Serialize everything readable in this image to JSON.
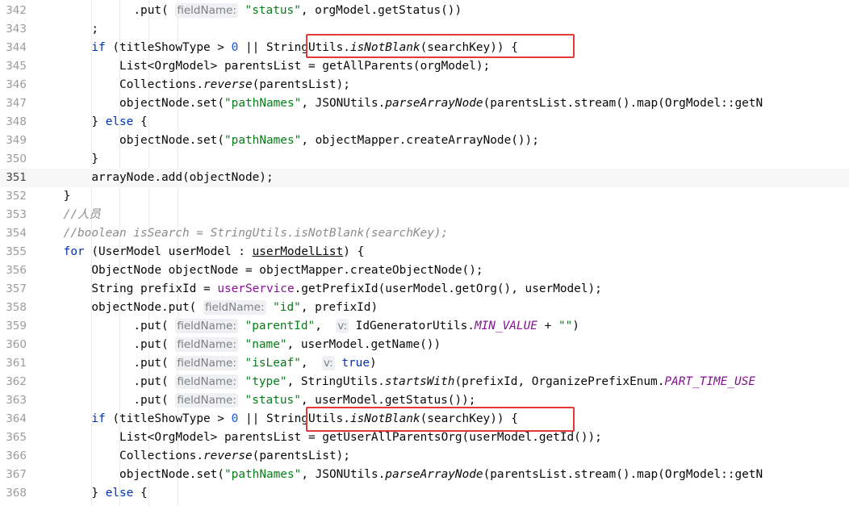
{
  "editor": {
    "current_line": "351",
    "lines": [
      {
        "n": "342",
        "indent": 14,
        "segs": [
          [
            "",
            ".put( "
          ],
          [
            "hint",
            "fieldName:"
          ],
          [
            "",
            " "
          ],
          [
            "str",
            "\"status\""
          ],
          [
            "",
            ", orgModel.getStatus())"
          ]
        ]
      },
      {
        "n": "343",
        "indent": 8,
        "segs": [
          [
            "",
            ";"
          ]
        ]
      },
      {
        "n": "344",
        "indent": 8,
        "segs": [
          [
            "kw",
            "if"
          ],
          [
            "",
            " (titleShowType > "
          ],
          [
            "num",
            "0"
          ],
          [
            "",
            " || StringUtils."
          ],
          [
            "it",
            "isNotBlank"
          ],
          [
            "",
            "(searchKey)) {"
          ]
        ]
      },
      {
        "n": "345",
        "indent": 12,
        "segs": [
          [
            "",
            "List<OrgModel> parentsList = getAllParents(orgModel);"
          ]
        ]
      },
      {
        "n": "346",
        "indent": 12,
        "segs": [
          [
            "",
            "Collections."
          ],
          [
            "it",
            "reverse"
          ],
          [
            "",
            "(parentsList);"
          ]
        ]
      },
      {
        "n": "347",
        "indent": 12,
        "segs": [
          [
            "",
            "objectNode.set("
          ],
          [
            "str",
            "\"pathNames\""
          ],
          [
            "",
            ", JSONUtils."
          ],
          [
            "it",
            "parseArrayNode"
          ],
          [
            "",
            "(parentsList.stream().map(OrgModel::getN"
          ]
        ]
      },
      {
        "n": "348",
        "indent": 8,
        "segs": [
          [
            "",
            "} "
          ],
          [
            "kw",
            "else"
          ],
          [
            "",
            " {"
          ]
        ]
      },
      {
        "n": "349",
        "indent": 12,
        "segs": [
          [
            "",
            "objectNode.set("
          ],
          [
            "str",
            "\"pathNames\""
          ],
          [
            "",
            ", objectMapper.createArrayNode());"
          ]
        ]
      },
      {
        "n": "350",
        "indent": 8,
        "segs": [
          [
            "",
            "}"
          ]
        ]
      },
      {
        "n": "351",
        "indent": 8,
        "segs": [
          [
            "",
            "arrayNode.add(objectNode);"
          ]
        ]
      },
      {
        "n": "352",
        "indent": 4,
        "segs": [
          [
            "",
            "}"
          ]
        ]
      },
      {
        "n": "353",
        "indent": 4,
        "segs": [
          [
            "cmt",
            "//人员"
          ]
        ]
      },
      {
        "n": "354",
        "indent": 4,
        "segs": [
          [
            "cmt",
            "//boolean isSearch = StringUtils.isNotBlank(searchKey);"
          ]
        ]
      },
      {
        "n": "355",
        "indent": 4,
        "segs": [
          [
            "kw",
            "for"
          ],
          [
            "",
            " (UserModel userModel : "
          ],
          [
            "ul",
            "userModelList"
          ],
          [
            "",
            ") {"
          ]
        ]
      },
      {
        "n": "356",
        "indent": 8,
        "segs": [
          [
            "",
            "ObjectNode objectNode = objectMapper.createObjectNode();"
          ]
        ]
      },
      {
        "n": "357",
        "indent": 8,
        "segs": [
          [
            "",
            "String prefixId = "
          ],
          [
            "field",
            "userService"
          ],
          [
            "",
            ".getPrefixId(userModel.getOrg(), userModel);"
          ]
        ]
      },
      {
        "n": "358",
        "indent": 8,
        "segs": [
          [
            "",
            "objectNode.put( "
          ],
          [
            "hint",
            "fieldName:"
          ],
          [
            "",
            " "
          ],
          [
            "str",
            "\"id\""
          ],
          [
            "",
            ", prefixId)"
          ]
        ]
      },
      {
        "n": "359",
        "indent": 14,
        "segs": [
          [
            "",
            ".put( "
          ],
          [
            "hint",
            "fieldName:"
          ],
          [
            "",
            " "
          ],
          [
            "str",
            "\"parentId\""
          ],
          [
            "",
            ",  "
          ],
          [
            "hint",
            "v:"
          ],
          [
            "",
            " IdGeneratorUtils."
          ],
          [
            "const",
            "MIN_VALUE"
          ],
          [
            "",
            " + "
          ],
          [
            "str",
            "\"\""
          ],
          [
            "",
            ")"
          ]
        ]
      },
      {
        "n": "360",
        "indent": 14,
        "segs": [
          [
            "",
            ".put( "
          ],
          [
            "hint",
            "fieldName:"
          ],
          [
            "",
            " "
          ],
          [
            "str",
            "\"name\""
          ],
          [
            "",
            ", userModel.getName())"
          ]
        ]
      },
      {
        "n": "361",
        "indent": 14,
        "segs": [
          [
            "",
            ".put( "
          ],
          [
            "hint",
            "fieldName:"
          ],
          [
            "",
            " "
          ],
          [
            "str",
            "\"isLeaf\""
          ],
          [
            "",
            ",  "
          ],
          [
            "hint",
            "v:"
          ],
          [
            "",
            " "
          ],
          [
            "kw",
            "true"
          ],
          [
            "",
            ")"
          ]
        ]
      },
      {
        "n": "362",
        "indent": 14,
        "segs": [
          [
            "",
            ".put( "
          ],
          [
            "hint",
            "fieldName:"
          ],
          [
            "",
            " "
          ],
          [
            "str",
            "\"type\""
          ],
          [
            "",
            ", StringUtils."
          ],
          [
            "it",
            "startsWith"
          ],
          [
            "",
            "(prefixId, OrganizePrefixEnum."
          ],
          [
            "const",
            "PART_TIME_USE"
          ]
        ]
      },
      {
        "n": "363",
        "indent": 14,
        "segs": [
          [
            "",
            ".put( "
          ],
          [
            "hint",
            "fieldName:"
          ],
          [
            "",
            " "
          ],
          [
            "str",
            "\"status\""
          ],
          [
            "",
            ", userModel.getStatus());"
          ]
        ]
      },
      {
        "n": "364",
        "indent": 8,
        "segs": [
          [
            "kw",
            "if"
          ],
          [
            "",
            " (titleShowType > "
          ],
          [
            "num",
            "0"
          ],
          [
            "",
            " || StringUtils."
          ],
          [
            "it",
            "isNotBlank"
          ],
          [
            "",
            "(searchKey)) {"
          ]
        ]
      },
      {
        "n": "365",
        "indent": 12,
        "segs": [
          [
            "",
            "List<OrgModel> parentsList = getUserAllParentsOrg(userModel.getId());"
          ]
        ]
      },
      {
        "n": "366",
        "indent": 12,
        "segs": [
          [
            "",
            "Collections."
          ],
          [
            "it",
            "reverse"
          ],
          [
            "",
            "(parentsList);"
          ]
        ]
      },
      {
        "n": "367",
        "indent": 12,
        "segs": [
          [
            "",
            "objectNode.set("
          ],
          [
            "str",
            "\"pathNames\""
          ],
          [
            "",
            ", JSONUtils."
          ],
          [
            "it",
            "parseArrayNode"
          ],
          [
            "",
            "(parentsList.stream().map(OrgModel::getN"
          ]
        ]
      },
      {
        "n": "368",
        "indent": 8,
        "segs": [
          [
            "",
            "} "
          ],
          [
            "kw",
            "else"
          ],
          [
            "",
            " {"
          ]
        ]
      }
    ]
  },
  "highlight_color": "#e53935"
}
